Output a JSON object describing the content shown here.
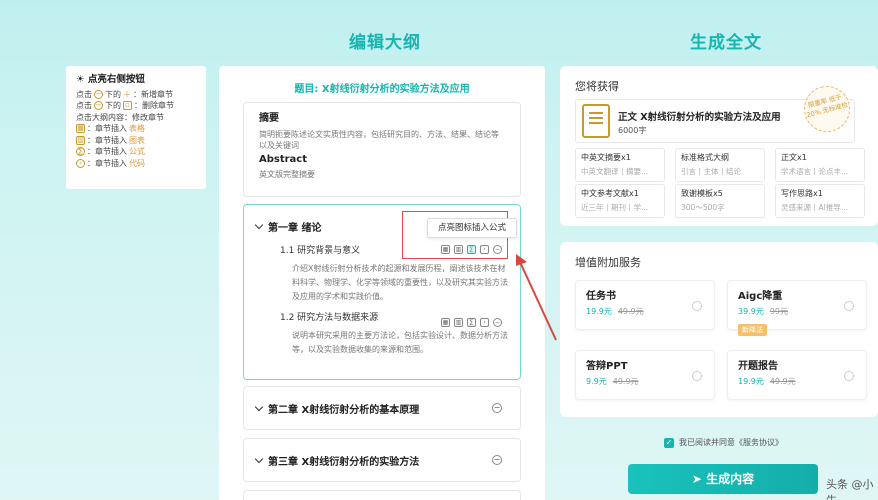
{
  "headings": {
    "left": "编辑大纲",
    "right": "生成全文"
  },
  "tips": {
    "title": "点亮右侧按钮",
    "rows": [
      {
        "a": "点击",
        "b": "下的",
        "c": "：新增章节"
      },
      {
        "a": "点击",
        "b": "下的",
        "c": "：删除章节"
      },
      {
        "a": "点击大纲内容：修改章节"
      },
      {
        "a": "：章节插入",
        "b": "表格"
      },
      {
        "a": "：章节插入",
        "b": "图表"
      },
      {
        "a": "：章节插入",
        "b": "公式"
      },
      {
        "a": "：章节插入",
        "b": "代码"
      }
    ]
  },
  "outline": {
    "title": "题目: X射线衍射分析的实验方法及应用",
    "abstract": {
      "h1": "摘要",
      "t1": "简明扼要陈述论文实质性内容，包括研究目的、方法、结果、结论等以及关键词",
      "h2": "Abstract",
      "t2": "英文版完整摘要"
    },
    "chapter1": {
      "title": "第一章  绪论",
      "callout": "点亮图标插入公式",
      "s1": "1.1  研究背景与意义",
      "p1": "介绍X射线衍射分析技术的起源和发展历程，阐述该技术在材料科学、物理学、化学等领域的重要性，以及研究其实验方法及应用的学术和实践价值。",
      "s2": "1.2  研究方法与数据来源",
      "p2": "说明本研究采用的主要方法论，包括实验设计、数据分析方法等，以及实验数据收集的来源和范围。"
    },
    "chapter2": "第二章  X射线衍射分析的基本原理",
    "chapter3": "第三章  X射线衍射分析的实验方法"
  },
  "get": {
    "title": "您将获得",
    "product": "正文  X射线衍射分析的实验方法及应用",
    "count": "6000字",
    "seal": "限重率 低于20% 无标准检",
    "features": [
      {
        "a": "中英文摘要x1",
        "b": "中英文翻译丨摘要..."
      },
      {
        "a": "标准格式大纲",
        "b": "引言丨主体丨结论"
      },
      {
        "a": "正文x1",
        "b": "学术语言丨论点丰..."
      },
      {
        "a": "中文参考文献x1",
        "b": "近三年丨期刊丨学..."
      },
      {
        "a": "致谢模板x5",
        "b": "300～500字"
      },
      {
        "a": "写作思路x1",
        "b": "灵感来源丨AI推导..."
      }
    ]
  },
  "services": {
    "title": "增值附加服务",
    "items": [
      {
        "n": "任务书",
        "p": "19.9元",
        "o": "49.9元"
      },
      {
        "n": "Aigc降重",
        "p": "39.9元",
        "o": "99元",
        "tag": "新降法"
      },
      {
        "n": "答辩PPT",
        "p": "9.9元",
        "o": "49.9元"
      },
      {
        "n": "开题报告",
        "p": "19.9元",
        "o": "49.9元"
      }
    ]
  },
  "agree": "我已阅读并同意《服务协议》",
  "generate": "生成内容",
  "watermark": "头条 @小牛"
}
